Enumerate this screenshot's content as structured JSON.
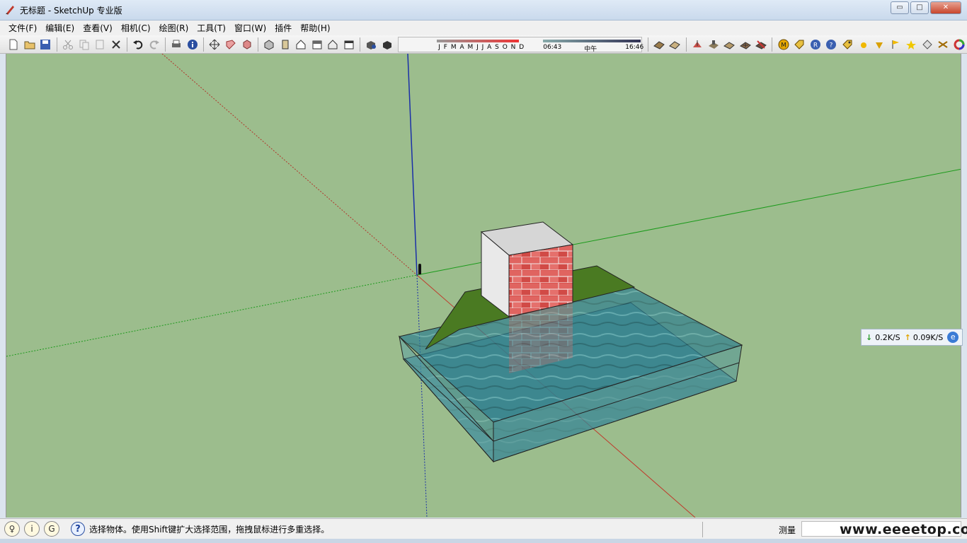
{
  "window": {
    "title": "无标题 - SketchUp 专业版",
    "controls": {
      "minimize": "▭",
      "maximize": "□",
      "close": "✕"
    }
  },
  "menubar": {
    "items": [
      "文件(F)",
      "编辑(E)",
      "查看(V)",
      "相机(C)",
      "绘图(R)",
      "工具(T)",
      "窗口(W)",
      "插件",
      "帮助(H)"
    ]
  },
  "toolbar": {
    "shadow_settings": {
      "months": "J F M A M J J A S O N D",
      "time_start": "06:43",
      "time_noon": "中午",
      "time_end": "16:46"
    }
  },
  "network_widget": {
    "download": "0.2K/S",
    "upload": "0.09K/S"
  },
  "statusbar": {
    "message": "选择物体。使用Shift键扩大选择范围，拖拽鼠标进行多重选择。",
    "measure_label": "测量",
    "measure_value": "",
    "watermark": "www.eeeetop.com"
  },
  "colors": {
    "viewport_bg": "#9cbd8d",
    "axis_red": "#c0392b",
    "axis_green": "#1a9a1a",
    "axis_blue": "#1a2fa8",
    "brick": "#d9534f",
    "water": "#2e7f8f",
    "terrain": "#4a7a22"
  }
}
